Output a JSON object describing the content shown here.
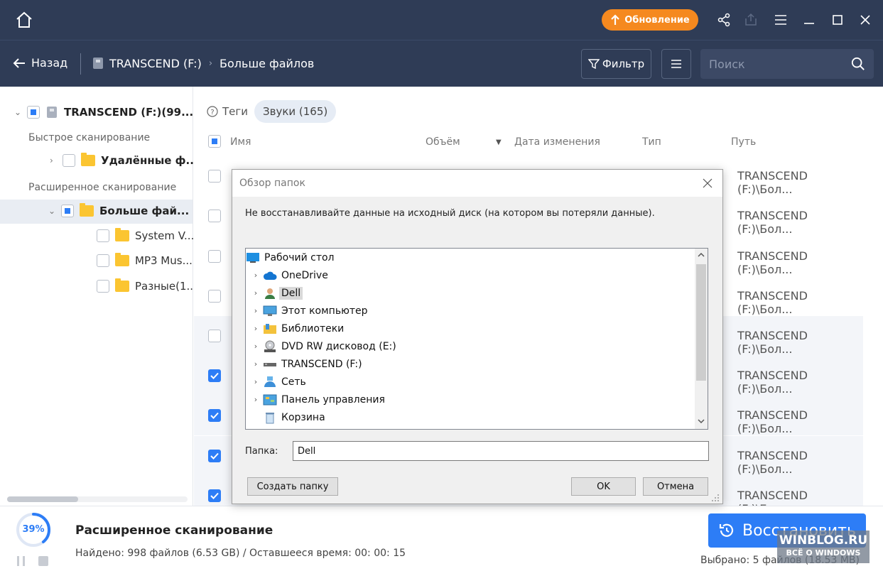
{
  "titlebar": {
    "update_label": "Обновление",
    "icons": [
      "home-icon",
      "share-icon",
      "export-icon",
      "menu-icon",
      "minimize-icon",
      "maximize-icon",
      "close-icon"
    ]
  },
  "navbar": {
    "back_label": "Назад",
    "drive_label": "TRANSCEND (F:)",
    "crumb_label": "Больше файлов",
    "filter_label": "Фильтр",
    "search_placeholder": "Поиск"
  },
  "tree": {
    "root_label": "TRANSCEND (F:)(99...",
    "quick_scan_label": "Быстрое сканирование",
    "deleted_label": "Удалённые ф...",
    "extended_scan_label": "Расширенное сканирование",
    "more_files_label": "Больше фай...",
    "children": [
      {
        "label": "System V..."
      },
      {
        "label": "MP3 Mus..."
      },
      {
        "label": "Разные(1..."
      }
    ]
  },
  "main": {
    "tags_label": "Теги",
    "sounds_chip": "Звуки (165)",
    "columns": {
      "name": "Имя",
      "size": "Объём",
      "date": "Дата изменения",
      "type": "Тип",
      "path": "Путь"
    },
    "rows": [
      {
        "path": "TRANSCEND (F:)\\Бол...",
        "checked": false
      },
      {
        "path": "TRANSCEND (F:)\\Бол...",
        "checked": false
      },
      {
        "path": "TRANSCEND (F:)\\Бол...",
        "checked": false
      },
      {
        "path": "TRANSCEND (F:)\\Бол...",
        "checked": false
      },
      {
        "path": "TRANSCEND (F:)\\Бол...",
        "checked": false
      },
      {
        "path": "TRANSCEND (F:)\\Бол...",
        "checked": true
      },
      {
        "path": "TRANSCEND (F:)\\Бол...",
        "checked": true
      },
      {
        "path": "TRANSCEND (F:)\\Бол...",
        "checked": true
      },
      {
        "path": "TRANSCEND (F:)\\Бол...",
        "checked": true
      }
    ]
  },
  "dialog": {
    "title": "Обзор папок",
    "hint": "Не восстанавливайте данные на исходный диск (на котором вы потеряли данные).",
    "tree_items": [
      {
        "label": "Рабочий стол",
        "icon": "desktop-icon",
        "has_arrow": false,
        "selected": false
      },
      {
        "label": "OneDrive",
        "icon": "cloud-icon",
        "has_arrow": true,
        "selected": false
      },
      {
        "label": "Dell",
        "icon": "user-icon",
        "has_arrow": true,
        "selected": true
      },
      {
        "label": "Этот компьютер",
        "icon": "computer-icon",
        "has_arrow": true,
        "selected": false
      },
      {
        "label": "Библиотеки",
        "icon": "libraries-icon",
        "has_arrow": true,
        "selected": false
      },
      {
        "label": "DVD RW дисковод (E:)",
        "icon": "dvd-icon",
        "has_arrow": true,
        "selected": false
      },
      {
        "label": "TRANSCEND (F:)",
        "icon": "usb-drive-icon",
        "has_arrow": true,
        "selected": false
      },
      {
        "label": "Сеть",
        "icon": "network-icon",
        "has_arrow": true,
        "selected": false
      },
      {
        "label": "Панель управления",
        "icon": "control-panel-icon",
        "has_arrow": true,
        "selected": false
      },
      {
        "label": "Корзина",
        "icon": "recycle-bin-icon",
        "has_arrow": false,
        "selected": false
      }
    ],
    "folder_label": "Папка:",
    "folder_value": "Dell",
    "new_folder_label": "Создать папку",
    "ok_label": "OK",
    "cancel_label": "Отмена"
  },
  "bottom": {
    "progress_text": "39%",
    "progress_value": 39,
    "scan_title": "Расширенное сканирование",
    "scan_info": "Найдено: 998 файлов (6.53 GB) / Оставшееся время: 00: 00: 15",
    "restore_label": "Восстановить",
    "selected_info": "Выбрано: 5 файлов (18.53 MB)",
    "watermark_line1": "WINBLOG.RU",
    "watermark_line2": "ВСЁ О WINDOWS"
  },
  "colors": {
    "header_bg": "#2f3c56",
    "accent": "#2d7df6",
    "update_orange": "#f5891f"
  }
}
